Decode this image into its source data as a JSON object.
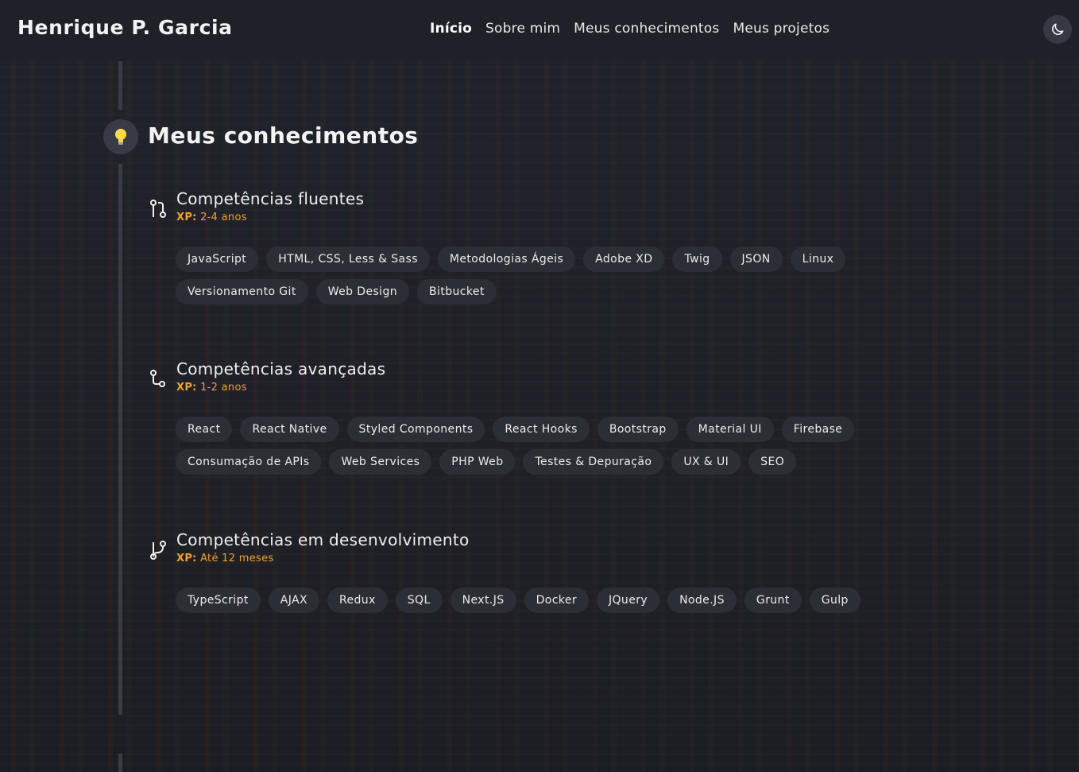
{
  "header": {
    "brand": "Henrique P. Garcia",
    "nav": [
      {
        "label": "Início",
        "active": true
      },
      {
        "label": "Sobre mim",
        "active": false
      },
      {
        "label": "Meus conhecimentos",
        "active": false
      },
      {
        "label": "Meus projetos",
        "active": false
      }
    ],
    "theme_toggle_icon": "moon-icon"
  },
  "section": {
    "icon": "lightbulb-icon",
    "title": "Meus conhecimentos"
  },
  "groups": [
    {
      "icon": "git-pull-request-icon",
      "title": "Competências fluentes",
      "xp_label": "XP:",
      "xp_value": "2-4 anos",
      "tags": [
        "JavaScript",
        "HTML, CSS, Less & Sass",
        "Metodologias Ágeis",
        "Adobe XD",
        "Twig",
        "JSON",
        "Linux",
        "Versionamento Git",
        "Web Design",
        "Bitbucket"
      ]
    },
    {
      "icon": "git-commit-icon",
      "title": "Competências avançadas",
      "xp_label": "XP:",
      "xp_value": "1-2 anos",
      "tags": [
        "React",
        "React Native",
        "Styled Components",
        "React Hooks",
        "Bootstrap",
        "Material UI",
        "Firebase",
        "Consumação de APIs",
        "Web Services",
        "PHP Web",
        "Testes & Depuração",
        "UX & UI",
        "SEO"
      ]
    },
    {
      "icon": "git-branch-icon",
      "title": "Competências em desenvolvimento",
      "xp_label": "XP:",
      "xp_value": "Até 12 meses",
      "tags": [
        "TypeScript",
        "AJAX",
        "Redux",
        "SQL",
        "Next.JS",
        "Docker",
        "JQuery",
        "Node.JS",
        "Grunt",
        "Gulp"
      ]
    }
  ],
  "colors": {
    "accent": "#f0a02e",
    "background": "#1d1f27",
    "tag_bg": "#2c2e36"
  }
}
